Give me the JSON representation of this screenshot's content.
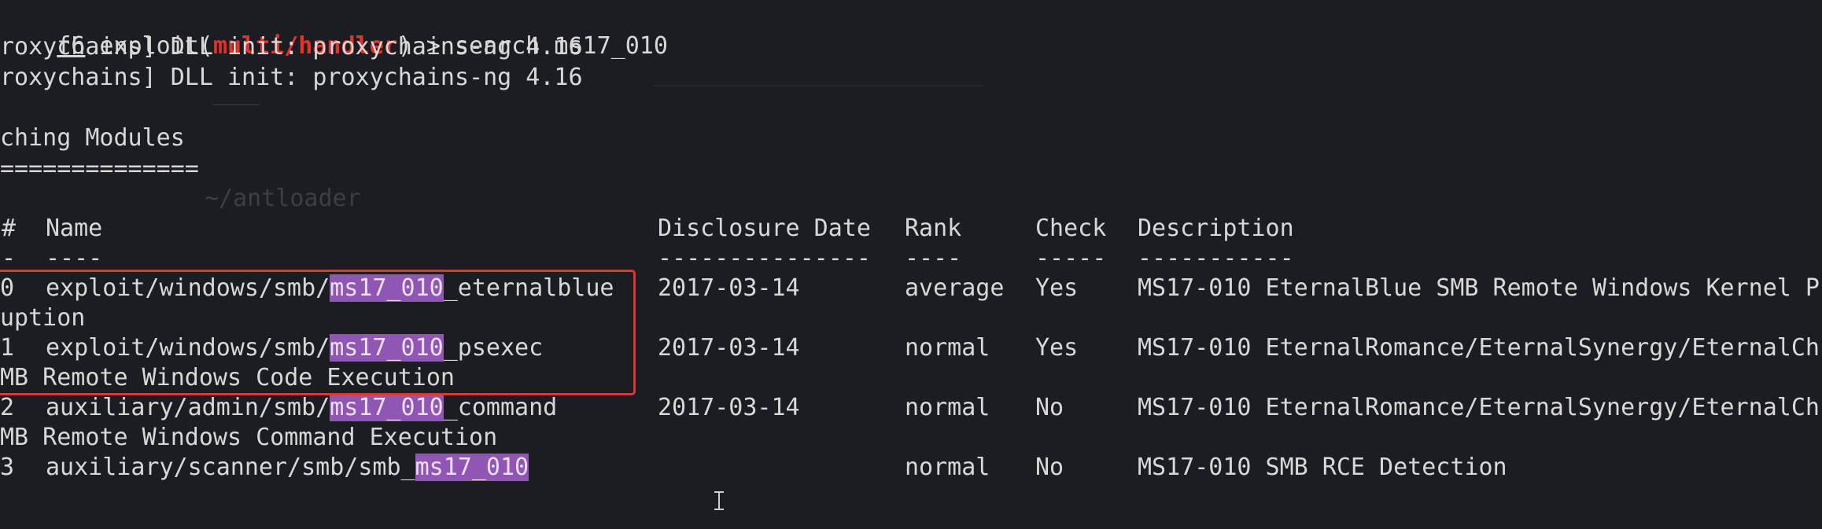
{
  "prompt": {
    "prefix": "f6",
    "exploit_word": " exploit(",
    "module": "multi/handler",
    "suffix": ") > search ms17_010"
  },
  "init_lines": [
    "roxychains] DLL init: proxychains-ng 4.16",
    "roxychains] DLL init: proxychains-ng 4.16"
  ],
  "section_title": "ching Modules",
  "section_rule": "==============",
  "ghost_text": "~/antloader",
  "table": {
    "headers": {
      "num": "#",
      "name": "Name",
      "date": "Disclosure Date",
      "rank": "Rank",
      "check": "Check",
      "description": "Description"
    },
    "separators": {
      "num": "-",
      "name": "----",
      "date": "---------------",
      "rank": "----",
      "check": "-----",
      "description": "-----------"
    },
    "rows": [
      {
        "num": "0",
        "name_pre": "exploit/windows/smb/",
        "name_match": "ms17_010",
        "name_post": "_eternalblue",
        "date": "2017-03-14",
        "rank": "average",
        "check": "Yes",
        "description": "MS17-010 EternalBlue SMB Remote Windows Kernel P",
        "continuation": "uption"
      },
      {
        "num": "1",
        "name_pre": "exploit/windows/smb/",
        "name_match": "ms17_010",
        "name_post": "_psexec",
        "date": "2017-03-14",
        "rank": "normal",
        "check": "Yes",
        "description": "MS17-010 EternalRomance/EternalSynergy/EternalCh",
        "continuation": "MB Remote Windows Code Execution"
      },
      {
        "num": "2",
        "name_pre": "auxiliary/admin/smb/",
        "name_match": "ms17_010",
        "name_post": "_command",
        "date": "2017-03-14",
        "rank": "normal",
        "check": "No",
        "description": "MS17-010 EternalRomance/EternalSynergy/EternalCh",
        "continuation": "MB Remote Windows Command Execution"
      },
      {
        "num": "3",
        "name_pre": "auxiliary/scanner/smb/smb_",
        "name_match": "ms17_010",
        "name_post": "",
        "date": "",
        "rank": "normal",
        "check": "No",
        "description": "MS17-010 SMB RCE Detection",
        "continuation": ""
      }
    ]
  },
  "colors": {
    "background": "#1b1d22",
    "text": "#d8d8d8",
    "module_red": "#e8302a",
    "match_highlight": "#8f56b4",
    "annotation_box": "#e03434"
  }
}
